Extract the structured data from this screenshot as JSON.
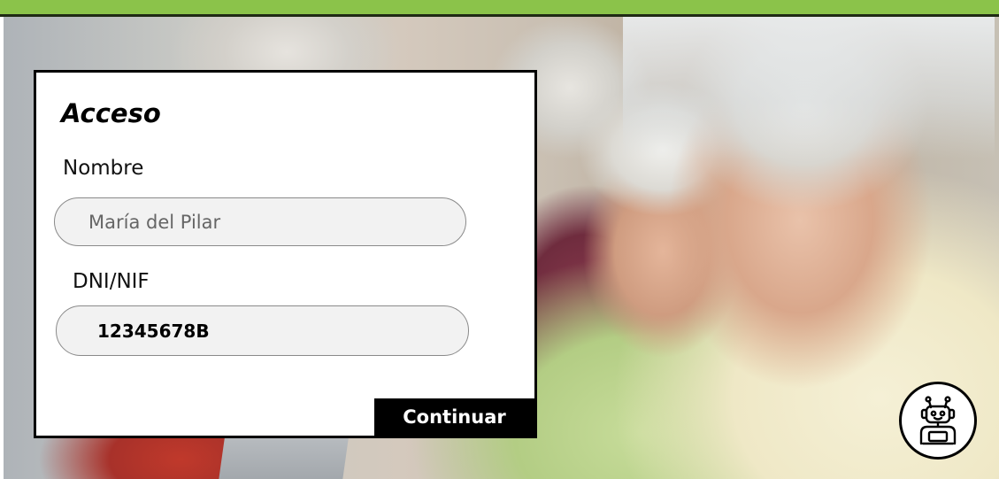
{
  "login": {
    "title": "Acceso",
    "name_label": "Nombre",
    "name_value": "María del Pilar",
    "id_label": "DNI/NIF",
    "id_value": "12345678B",
    "continue_label": "Continuar"
  },
  "assistant": {
    "icon": "robot-icon"
  },
  "colors": {
    "accent_bar": "#8bc34a",
    "card_border": "#000000",
    "button_bg": "#000000",
    "input_bg": "#f2f2f2"
  }
}
